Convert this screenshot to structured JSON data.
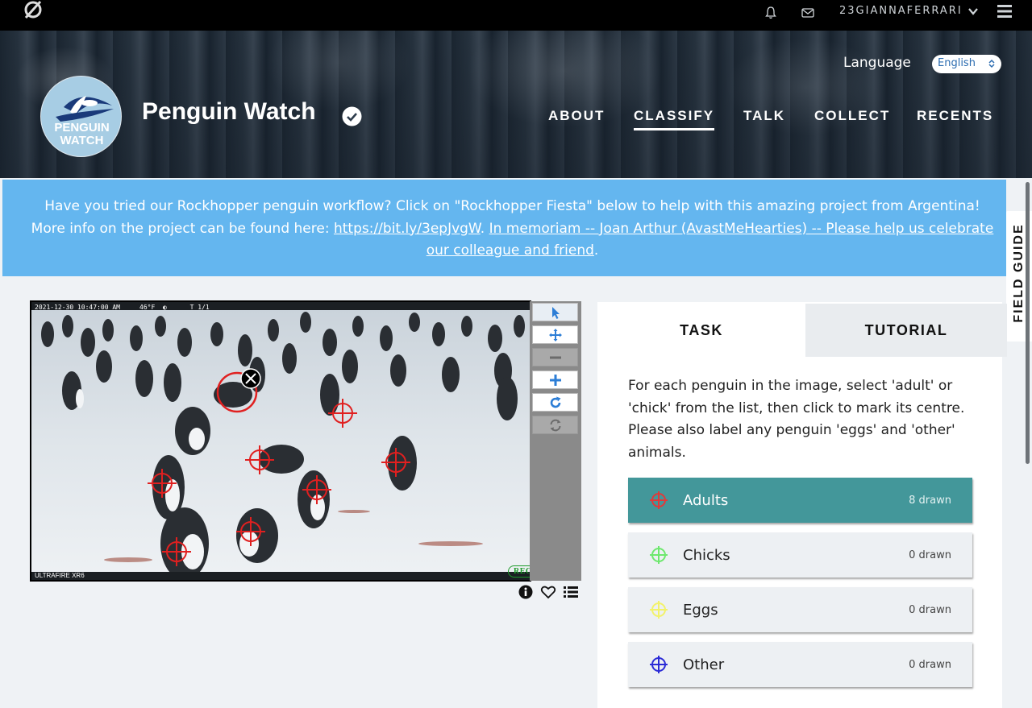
{
  "topbar": {
    "username": "23GIANNAFERRARI",
    "icons": [
      "zooniverse-logo-icon",
      "bell-icon",
      "mail-icon",
      "chevron-down-icon",
      "hamburger-menu-icon"
    ]
  },
  "header": {
    "language_label": "Language",
    "language_value": "English",
    "project_title": "Penguin Watch",
    "avatar_line1": "PENGUIN",
    "avatar_line2": "WATCH",
    "nav": [
      {
        "label": "ABOUT",
        "active": false
      },
      {
        "label": "CLASSIFY",
        "active": true
      },
      {
        "label": "TALK",
        "active": false
      },
      {
        "label": "COLLECT",
        "active": false
      },
      {
        "label": "RECENTS",
        "active": false
      }
    ]
  },
  "announcement": {
    "text_part1": "Have you tried our Rockhopper penguin workflow? Click on \"Rockhopper Fiesta\" below to help with this amazing project from Argentina! More info on the project can be found here: ",
    "link1": "https://bit.ly/3epJvgW",
    "sep": ". ",
    "link2": "In memoriam -- Joan Arthur (AvastMeHearties) -- Please help us celebrate our colleague and friend",
    "end": "."
  },
  "field_guide": {
    "label": "FIELD GUIDE"
  },
  "subject": {
    "stamp": "2021-12-30 10:47:00 AM     46°F  ◐      T 1/1",
    "camera_model": "ULTRAFIRE XR6",
    "brand": "RECONYX"
  },
  "toolbar": {
    "tools": [
      "pointer-icon",
      "pan-icon",
      "zoom-out-icon",
      "zoom-in-icon",
      "rotate-icon",
      "reset-icon"
    ]
  },
  "meta_icons": [
    "info-icon",
    "heart-icon",
    "list-icon"
  ],
  "task": {
    "tabs": {
      "task": "TASK",
      "tutorial": "TUTORIAL"
    },
    "instructions": "For each penguin in the image, select 'adult' or 'chick' from the list, then click to mark its centre. Please also label any penguin 'eggs' and 'other' animals.",
    "tools": [
      {
        "label": "Adults",
        "count": "8 drawn",
        "color": "#e03a3a",
        "active": true
      },
      {
        "label": "Chicks",
        "count": "0 drawn",
        "color": "#6ee86e",
        "active": false
      },
      {
        "label": "Eggs",
        "count": "0 drawn",
        "color": "#f2f26a",
        "active": false
      },
      {
        "label": "Other",
        "count": "0 drawn",
        "color": "#2b2bd6",
        "active": false
      }
    ]
  },
  "colors": {
    "accent_teal": "#43979a",
    "banner_blue": "#64b6ef",
    "mark_red": "#e02020"
  }
}
